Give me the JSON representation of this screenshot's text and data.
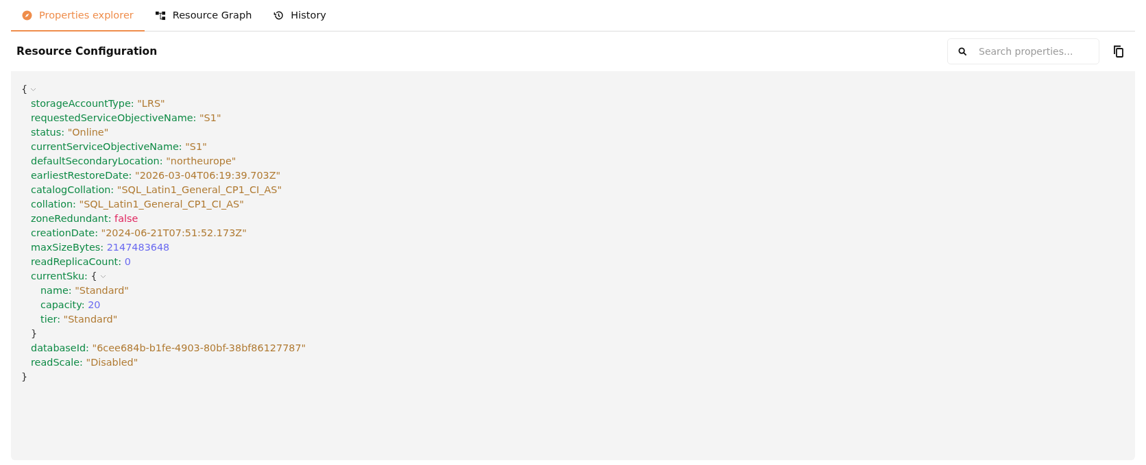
{
  "tabs": [
    {
      "label": "Properties explorer",
      "kind": "compass",
      "selected": true
    },
    {
      "label": "Resource Graph",
      "kind": "graph",
      "selected": false
    },
    {
      "label": "History",
      "kind": "history",
      "selected": false
    }
  ],
  "panel": {
    "title": "Resource Configuration",
    "search": {
      "placeholder": "Search properties..."
    }
  },
  "json_view": {
    "open_brace": "{",
    "expanded": true,
    "close_brace": "}",
    "properties": [
      {
        "key": "storageAccountType:",
        "value": "\"LRS\"",
        "kind": "string"
      },
      {
        "key": "requestedServiceObjectiveName:",
        "value": "\"S1\"",
        "kind": "string"
      },
      {
        "key": "status:",
        "value": "\"Online\"",
        "kind": "string"
      },
      {
        "key": "currentServiceObjectiveName:",
        "value": "\"S1\"",
        "kind": "string"
      },
      {
        "key": "defaultSecondaryLocation:",
        "value": "\"northeurope\"",
        "kind": "string"
      },
      {
        "key": "earliestRestoreDate:",
        "value": "\"2026-03-04T06:19:39.703Z\"",
        "kind": "string"
      },
      {
        "key": "catalogCollation:",
        "value": "\"SQL_Latin1_General_CP1_CI_AS\"",
        "kind": "string"
      },
      {
        "key": "collation:",
        "value": "\"SQL_Latin1_General_CP1_CI_AS\"",
        "kind": "string"
      },
      {
        "key": "zoneRedundant:",
        "value": "false",
        "kind": "boolean"
      },
      {
        "key": "creationDate:",
        "value": "\"2024-06-21T07:51:52.173Z\"",
        "kind": "string"
      },
      {
        "key": "maxSizeBytes:",
        "value": "2147483648",
        "kind": "number"
      },
      {
        "key": "readReplicaCount:",
        "value": "0",
        "kind": "number"
      },
      {
        "key": "currentSku:",
        "kind": "object",
        "open_brace": "{",
        "expanded": true,
        "close_brace": "}",
        "children": [
          {
            "key": "name:",
            "value": "\"Standard\"",
            "kind": "string"
          },
          {
            "key": "capacity:",
            "value": "20",
            "kind": "number"
          },
          {
            "key": "tier:",
            "value": "\"Standard\"",
            "kind": "string"
          }
        ]
      },
      {
        "key": "databaseId:",
        "value": "\"6cee684b-b1fe-4903-80bf-38bf86127787\"",
        "kind": "string"
      },
      {
        "key": "readScale:",
        "value": "\"Disabled\"",
        "kind": "string"
      }
    ]
  }
}
